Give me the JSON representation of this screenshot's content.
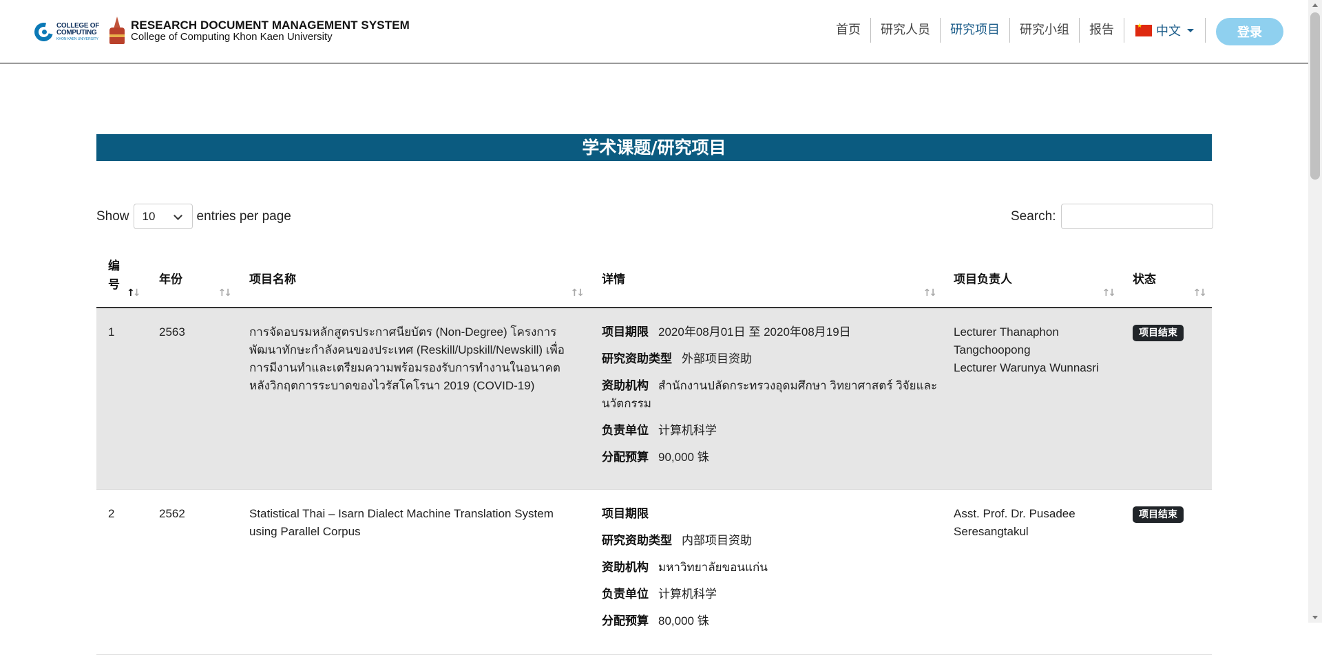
{
  "header": {
    "logo_text_line1": "COLLEGE OF",
    "logo_text_line2": "COMPUTING",
    "logo_text_small": "KHON KAEN UNIVERSITY",
    "title": "RESEARCH DOCUMENT MANAGEMENT SYSTEM",
    "subtitle": "College of Computing Khon Kaen University",
    "nav": [
      {
        "label": "首页",
        "active": false
      },
      {
        "label": "研究人员",
        "active": false
      },
      {
        "label": "研究项目",
        "active": true
      },
      {
        "label": "研究小组",
        "active": false
      },
      {
        "label": "报告",
        "active": false
      }
    ],
    "language": "中文",
    "language_flag": "china-flag-icon",
    "login_label": "登录",
    "colors": {
      "active_nav": "#1c5d8a",
      "login_bg": "#8fd0ef"
    }
  },
  "page": {
    "title": "学术课题/研究项目",
    "title_bg": "#0b5b80"
  },
  "controls": {
    "show_label": "Show",
    "per_page_value": "10",
    "per_page_suffix": "entries per page",
    "search_label": "Search:",
    "search_value": ""
  },
  "table": {
    "columns": [
      {
        "label": "编号",
        "sort": "asc"
      },
      {
        "label": "年份",
        "sort": "none"
      },
      {
        "label": "项目名称",
        "sort": "none"
      },
      {
        "label": "详情",
        "sort": "none"
      },
      {
        "label": "项目负责人",
        "sort": "none"
      },
      {
        "label": "状态",
        "sort": "none"
      }
    ],
    "detail_keys": {
      "period": "项目期限",
      "fund_type": "研究资助类型",
      "funder": "资助机构",
      "unit": "负责单位",
      "budget": "分配预算"
    },
    "rows": [
      {
        "no": "1",
        "year": "2563",
        "name": "การจัดอบรมหลักสูตรประกาศนียบัตร (Non-Degree) โครงการพัฒนาทักษะกำลังคนของประเทศ (Reskill/Upskill/Newskill) เพื่อการมีงานทำและเตรียมความพร้อมรองรับการทำงานในอนาคตหลังวิกฤตการระบาดของไวรัสโคโรนา 2019 (COVID-19)",
        "period": "2020年08月01日 至 2020年08月19日",
        "fund_type": "外部项目资助",
        "funder": "สำนักงานปลัดกระทรวงอุดมศึกษา วิทยาศาสตร์ วิจัยและนวัตกรรม",
        "unit": "计算机科学",
        "budget": "90,000 铢",
        "leads": [
          "Lecturer Thanaphon",
          "Tangchoopong",
          "Lecturer Warunya Wunnasri"
        ],
        "status": "项目结束"
      },
      {
        "no": "2",
        "year": "2562",
        "name": "Statistical Thai – Isarn Dialect Machine Translation System using Parallel Corpus",
        "period": "",
        "fund_type": "内部项目资助",
        "funder": "มหาวิทยาลัยขอนแก่น",
        "unit": "计算机科学",
        "budget": "80,000 铢",
        "leads": [
          "Asst. Prof. Dr. Pusadee",
          "Seresangtakul"
        ],
        "status": "项目结束"
      }
    ]
  }
}
